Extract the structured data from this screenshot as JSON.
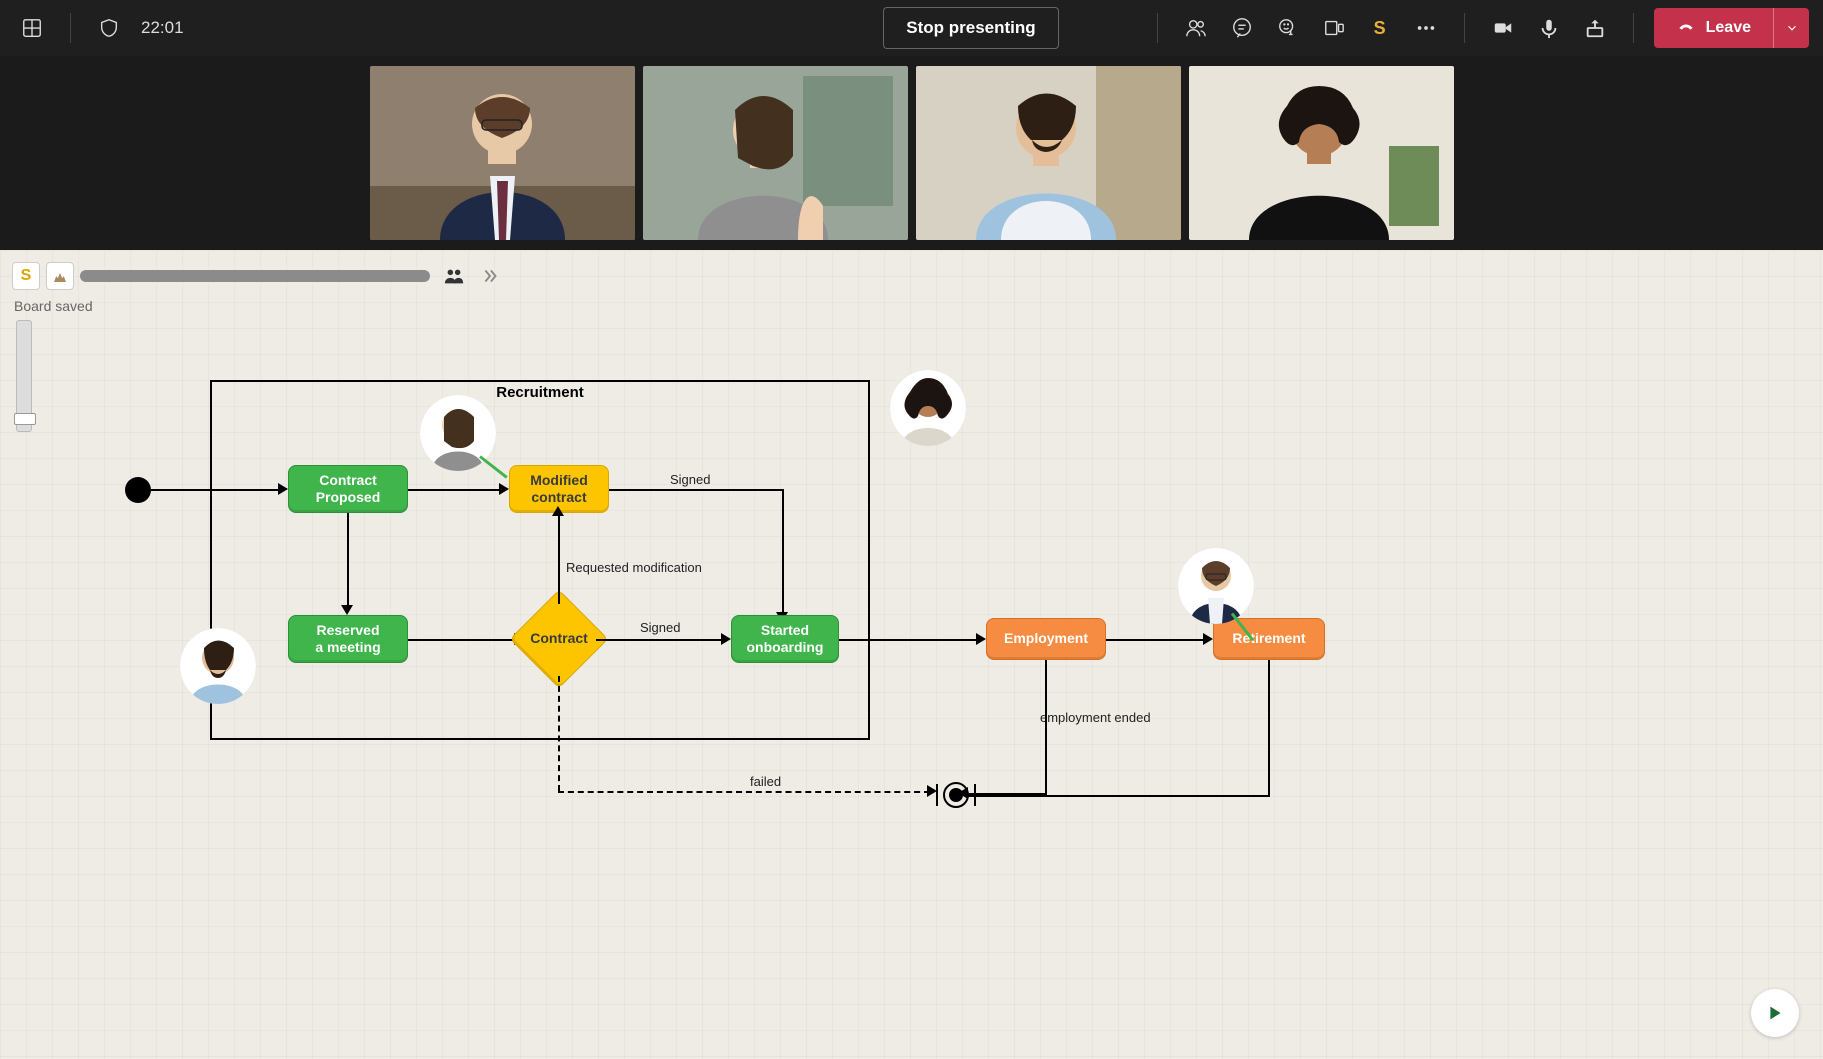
{
  "topbar": {
    "timer": "22:01",
    "stop_presenting_label": "Stop presenting",
    "leave_label": "Leave"
  },
  "board": {
    "status": "Board saved"
  },
  "flow": {
    "section_label": "Recruitment",
    "nodes": {
      "contract_proposed": "Contract\nProposed",
      "modified_contract": "Modified\ncontract",
      "reserved_meeting": "Reserved\na meeting",
      "contract": "Contract",
      "started_onboarding": "Started\nonboarding",
      "employment": "Employment",
      "retirement": "Retirement"
    },
    "edges": {
      "signed1": "Signed",
      "signed2": "Signed",
      "requested_mod": "Requested modification",
      "failed": "failed",
      "employment_ended": "employment ended"
    }
  }
}
